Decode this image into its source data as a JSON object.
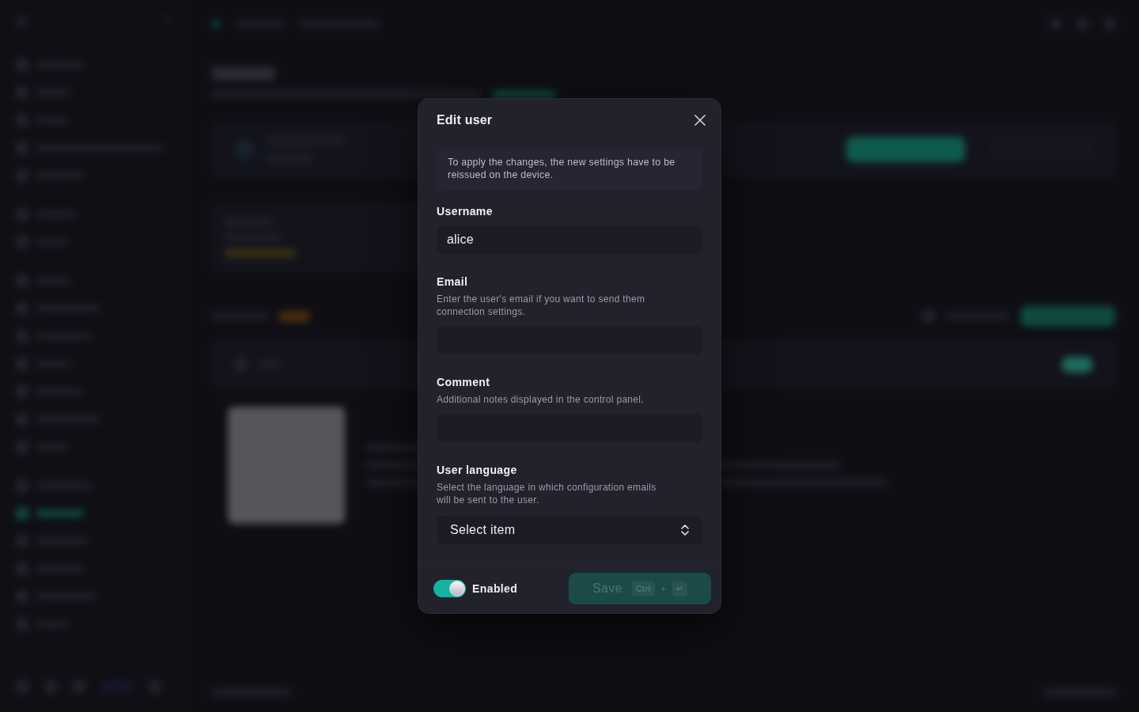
{
  "dialog": {
    "title": "Edit user",
    "notice": "To apply the changes, the new settings have to be reissued on the device.",
    "fields": [
      {
        "kind": "text",
        "label": "Username",
        "value": "alice"
      },
      {
        "kind": "text",
        "label": "Email",
        "description": "Enter the user's email if you want to send them connection settings."
      },
      {
        "kind": "text",
        "label": "Comment",
        "description": "Additional notes displayed in the control panel."
      },
      {
        "kind": "select",
        "label": "User language",
        "description": "Select the language in which configuration emails will be sent to the user.",
        "placeholder": "Select item"
      }
    ],
    "footer": {
      "toggle": {
        "label": "Enabled",
        "on": true
      },
      "save_button": {
        "label": "Save",
        "disabled": true,
        "shortcut": [
          {
            "kind": "key",
            "text": "Ctrl"
          },
          {
            "kind": "plus",
            "text": "+"
          },
          {
            "kind": "key",
            "text": "↵"
          }
        ]
      }
    }
  }
}
